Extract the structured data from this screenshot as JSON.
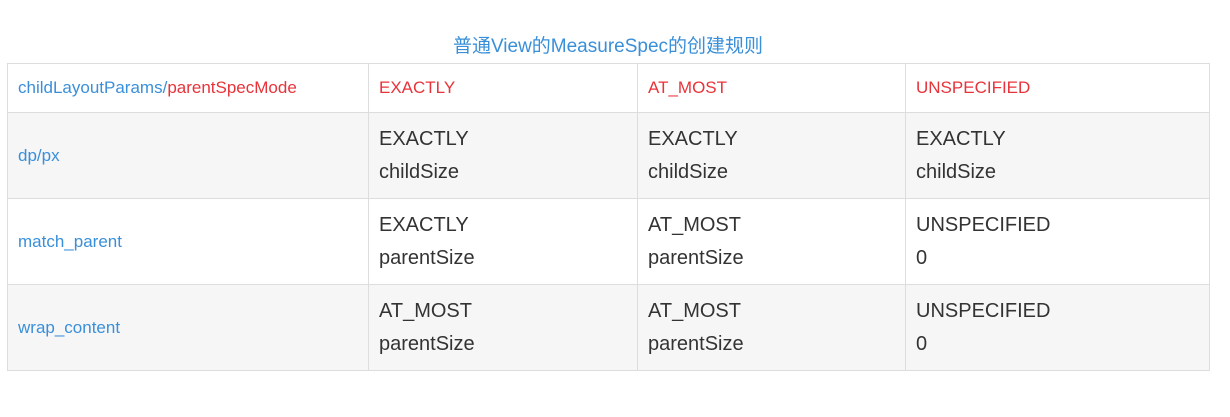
{
  "caption": "普通View的MeasureSpec的创建规则",
  "header": {
    "corner_left": "childLayoutParams",
    "corner_sep": "/",
    "corner_right": "parentSpecMode",
    "cols": [
      "EXACTLY",
      "AT_MOST",
      "UNSPECIFIED"
    ]
  },
  "rows": [
    {
      "label": "dp/px",
      "cells": [
        {
          "mode": "EXACTLY",
          "size": "childSize"
        },
        {
          "mode": "EXACTLY",
          "size": "childSize"
        },
        {
          "mode": "EXACTLY",
          "size": "childSize"
        }
      ]
    },
    {
      "label": "match_parent",
      "cells": [
        {
          "mode": "EXACTLY",
          "size": "parentSize"
        },
        {
          "mode": "AT_MOST",
          "size": "parentSize"
        },
        {
          "mode": "UNSPECIFIED",
          "size": "0"
        }
      ]
    },
    {
      "label": "wrap_content",
      "cells": [
        {
          "mode": "AT_MOST",
          "size": "parentSize"
        },
        {
          "mode": "AT_MOST",
          "size": "parentSize"
        },
        {
          "mode": "UNSPECIFIED",
          "size": "0"
        }
      ]
    }
  ],
  "colors": {
    "blue": "#3a8fd9",
    "red": "#e8333a",
    "text": "#333333",
    "stripe": "#f6f6f6",
    "border": "#dddddd"
  }
}
